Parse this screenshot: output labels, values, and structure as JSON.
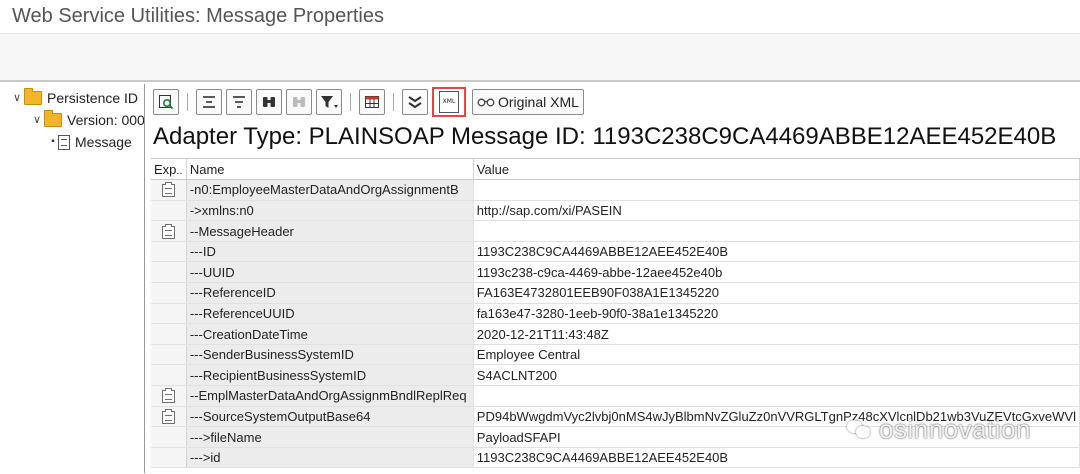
{
  "window": {
    "title": "Web Service Utilities: Message Properties"
  },
  "tree": {
    "items": [
      {
        "label": "Persistence ID",
        "level": 0,
        "icon": "folder-icon",
        "expanded": true
      },
      {
        "label": "Version: 000",
        "level": 1,
        "icon": "folder-icon",
        "expanded": true
      },
      {
        "label": "Message",
        "level": 2,
        "icon": "document-icon"
      }
    ]
  },
  "toolbar": {
    "buttons": [
      {
        "name": "details-button",
        "glyph": "⊡"
      },
      {
        "name": "align-top-button",
        "glyph": "☰"
      },
      {
        "name": "align-button",
        "glyph": "≡"
      },
      {
        "name": "find-button",
        "glyph": "⚲"
      },
      {
        "name": "find-next-button",
        "glyph": "⚲"
      },
      {
        "name": "filter-button",
        "glyph": "▼"
      },
      {
        "name": "layout-button",
        "glyph": "▦"
      },
      {
        "name": "collapse-button",
        "glyph": "≚"
      }
    ],
    "xml_icon_text": "XML",
    "original_xml_label": "Original XML",
    "glasses_glyph": "👓"
  },
  "heading": "Adapter Type: PLAINSOAP Message ID: 1193C238C9CA4469ABBE12AEE452E40B",
  "table": {
    "headers": {
      "exp": "Exp",
      "name": "Name",
      "value": "Value"
    },
    "rows": [
      {
        "icon": true,
        "name": "-n0:EmployeeMasterDataAndOrgAssignmentB",
        "value": ""
      },
      {
        "icon": false,
        "name": "->xmlns:n0",
        "value": "http://sap.com/xi/PASEIN"
      },
      {
        "icon": true,
        "name": "--MessageHeader",
        "value": ""
      },
      {
        "icon": false,
        "name": "---ID",
        "value": "1193C238C9CA4469ABBE12AEE452E40B"
      },
      {
        "icon": false,
        "name": "---UUID",
        "value": "1193c238-c9ca-4469-abbe-12aee452e40b"
      },
      {
        "icon": false,
        "name": "---ReferenceID",
        "value": "FA163E4732801EEB90F038A1E1345220"
      },
      {
        "icon": false,
        "name": "---ReferenceUUID",
        "value": "fa163e47-3280-1eeb-90f0-38a1e1345220"
      },
      {
        "icon": false,
        "name": "---CreationDateTime",
        "value": "2020-12-21T11:43:48Z"
      },
      {
        "icon": false,
        "name": "---SenderBusinessSystemID",
        "value": "Employee Central"
      },
      {
        "icon": false,
        "name": "---RecipientBusinessSystemID",
        "value": "S4ACLNT200"
      },
      {
        "icon": true,
        "name": "--EmplMasterDataAndOrgAssignmBndlReplReq",
        "value": ""
      },
      {
        "icon": true,
        "name": "---SourceSystemOutputBase64",
        "value": "PD94bWwgdmVyc2lvbj0nMS4wJyBlbmNvZGluZz0nVVRGLTgnPz48cXVlcnlDb21wb3VuZEVtcGxveWVl"
      },
      {
        "icon": false,
        "name": "--->fileName",
        "value": "PayloadSFAPI"
      },
      {
        "icon": false,
        "name": "--->id",
        "value": "1193C238C9CA4469ABBE12AEE452E40B"
      }
    ]
  },
  "watermark": {
    "text": "osinnovation"
  }
}
